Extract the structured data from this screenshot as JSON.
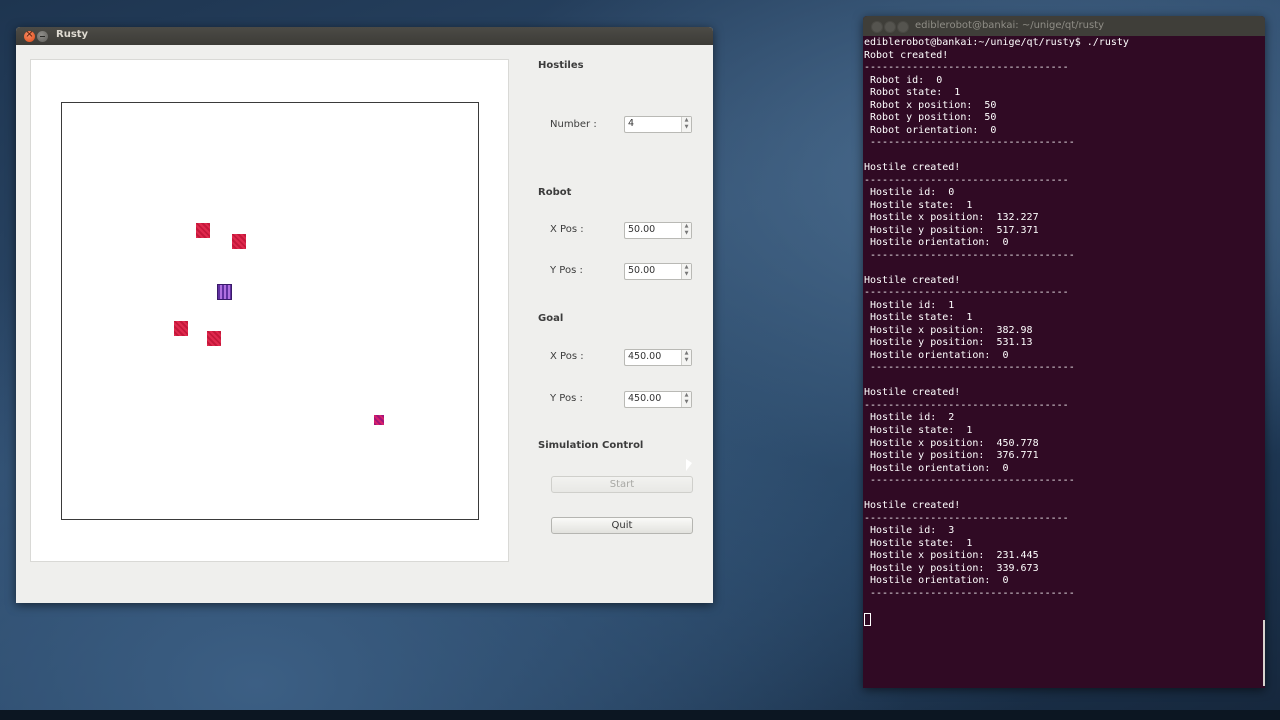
{
  "rusty_window": {
    "title": "Rusty",
    "hostiles": {
      "section_label": "Hostiles",
      "number_label": "Number :",
      "number_value": "4"
    },
    "robot": {
      "section_label": "Robot",
      "x_label": "X Pos :",
      "x_value": "50.00",
      "y_label": "Y Pos :",
      "y_value": "50.00"
    },
    "goal": {
      "section_label": "Goal",
      "x_label": "X Pos :",
      "x_value": "450.00",
      "y_label": "Y Pos :",
      "y_value": "450.00"
    },
    "simulation": {
      "section_label": "Simulation Control",
      "start_label": "Start",
      "quit_label": "Quit"
    }
  },
  "terminal": {
    "title": "ediblerobot@bankai: ~/unige/qt/rusty",
    "lines": [
      "ediblerobot@bankai:~/unige/qt/rusty$ ./rusty",
      "Robot created!",
      "----------------------------------",
      " Robot id:  0",
      " Robot state:  1",
      " Robot x position:  50",
      " Robot y position:  50",
      " Robot orientation:  0",
      " ----------------------------------",
      "",
      "Hostile created!",
      "----------------------------------",
      " Hostile id:  0",
      " Hostile state:  1",
      " Hostile x position:  132.227",
      " Hostile y position:  517.371",
      " Hostile orientation:  0",
      " ----------------------------------",
      "",
      "Hostile created!",
      "----------------------------------",
      " Hostile id:  1",
      " Hostile state:  1",
      " Hostile x position:  382.98",
      " Hostile y position:  531.13",
      " Hostile orientation:  0",
      " ----------------------------------",
      "",
      "Hostile created!",
      "----------------------------------",
      " Hostile id:  2",
      " Hostile state:  1",
      " Hostile x position:  450.778",
      " Hostile y position:  376.771",
      " Hostile orientation:  0",
      " ----------------------------------",
      "",
      "Hostile created!",
      "----------------------------------",
      " Hostile id:  3",
      " Hostile state:  1",
      " Hostile x position:  231.445",
      " Hostile y position:  339.673",
      " Hostile orientation:  0",
      " ----------------------------------",
      ""
    ]
  }
}
